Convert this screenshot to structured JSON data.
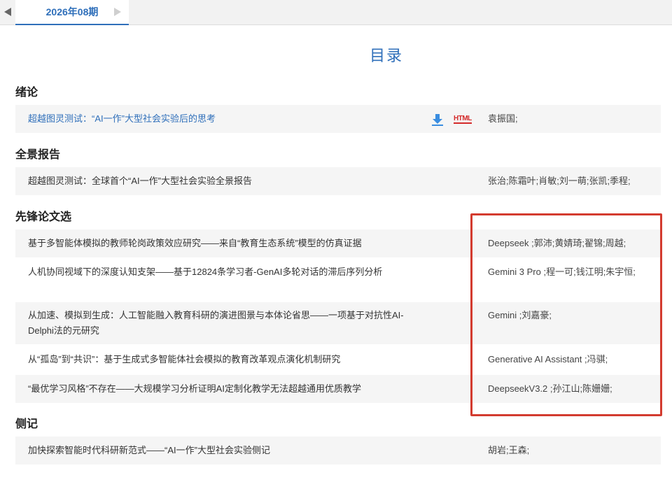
{
  "period": {
    "label": "2026年08期"
  },
  "page_title": "目录",
  "sections": [
    {
      "heading": "绪论",
      "rows": [
        {
          "title": "超越图灵测试：“AI一作”大型社会实验后的思考",
          "authors": "袁振国;"
        }
      ]
    },
    {
      "heading": "全景报告",
      "rows": [
        {
          "title": "超越图灵测试：全球首个“AI一作”大型社会实验全景报告",
          "authors": "张治;陈霜叶;肖敏;刘一萌;张凯;季程;"
        }
      ]
    },
    {
      "heading": "先锋论文选",
      "rows": [
        {
          "title": "基于多智能体模拟的教师轮岗政策效应研究——来自“教育生态系统”模型的仿真证据",
          "authors": "Deepseek ;郭沛;黄婧琦;翟锦;周越;"
        },
        {
          "title": "人机协同视域下的深度认知支架——基于12824条学习者-GenAI多轮对话的滞后序列分析",
          "authors": "Gemini 3 Pro ;程一可;钱江明;朱宇恒;"
        },
        {
          "title": "从加速、模拟到生成：人工智能融入教育科研的演进图景与本体论省思——一项基于对抗性AI-Delphi法的元研究",
          "authors": "Gemini ;刘嘉豪;"
        },
        {
          "title": "从“孤岛”到“共识”：基于生成式多智能体社会模拟的教育改革观点演化机制研究",
          "authors": "Generative AI Assistant ;冯骐;"
        },
        {
          "title": "“最优学习风格”不存在——大规模学习分析证明AI定制化教学无法超越通用优质教学",
          "authors": "DeepseekV3.2 ;孙江山;陈姗姗;"
        }
      ]
    },
    {
      "heading": "侧记",
      "rows": [
        {
          "title": "加快探索智能时代科研新范式——“AI一作”大型社会实验侧记",
          "authors": "胡岩;王森;"
        }
      ]
    }
  ],
  "html_badge": "HTML",
  "icons": {
    "prev": "triangle-left-icon",
    "next": "triangle-right-icon",
    "download": "download-icon",
    "html": "html-icon"
  },
  "colors": {
    "accent": "#2f6fba",
    "highlight": "#d33b2f",
    "row_bg": "#f5f5f5",
    "html_red": "#d42a2a"
  }
}
